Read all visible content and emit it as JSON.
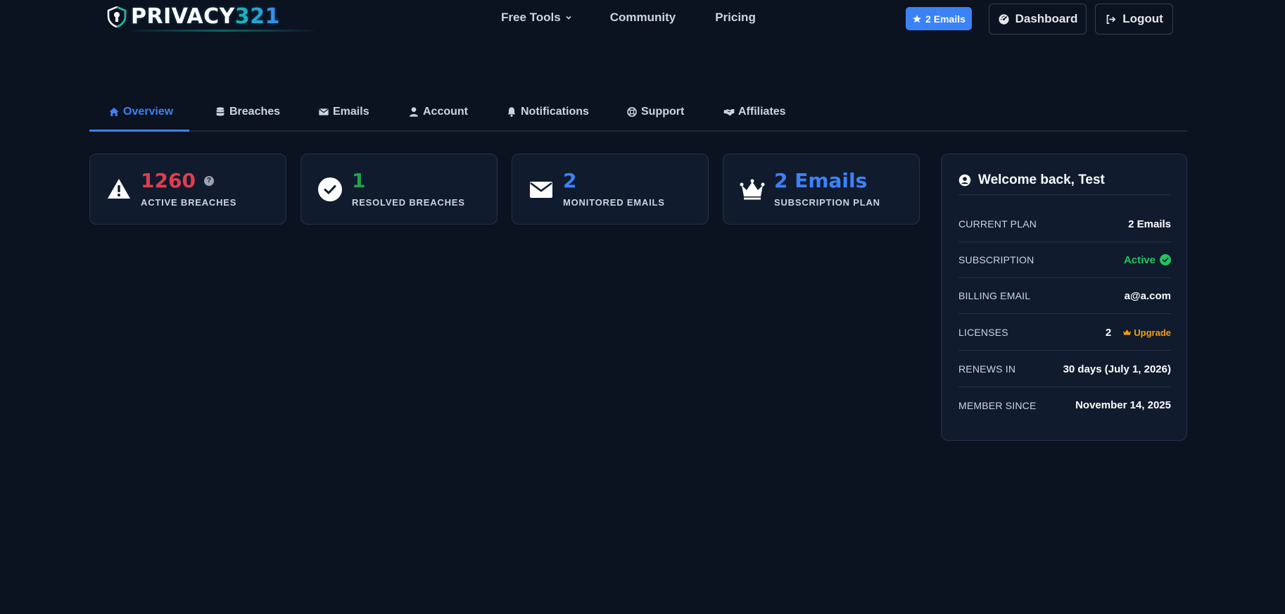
{
  "brand": {
    "name_main": "PRIVACY",
    "name_num": "321"
  },
  "nav": {
    "free_tools": "Free Tools",
    "community": "Community",
    "pricing": "Pricing",
    "plan_badge": "2 Emails",
    "dashboard": "Dashboard",
    "logout": "Logout"
  },
  "tabs": [
    {
      "label": "Overview",
      "icon": "home-icon",
      "active": true
    },
    {
      "label": "Breaches",
      "icon": "database-icon"
    },
    {
      "label": "Emails",
      "icon": "envelope-icon"
    },
    {
      "label": "Account",
      "icon": "user-icon"
    },
    {
      "label": "Notifications",
      "icon": "bell-icon"
    },
    {
      "label": "Support",
      "icon": "lifering-icon"
    },
    {
      "label": "Affiliates",
      "icon": "handshake-icon"
    }
  ],
  "stats": [
    {
      "value": "1260",
      "label": "ACTIVE BREACHES",
      "color": "#e03e4f",
      "icon": "warning-icon",
      "help": "?"
    },
    {
      "value": "1",
      "label": "RESOLVED BREACHES",
      "color": "#22a34a",
      "icon": "check-circle-icon"
    },
    {
      "value": "2",
      "label": "MONITORED EMAILS",
      "color": "#3b82f6",
      "icon": "envelope-icon"
    },
    {
      "value": "2 Emails",
      "label": "SUBSCRIPTION PLAN",
      "color": "#3b82f6",
      "icon": "crown-icon"
    }
  ],
  "account": {
    "welcome": "Welcome back, Test",
    "rows": [
      {
        "key": "CURRENT PLAN",
        "value": "2 Emails"
      },
      {
        "key": "SUBSCRIPTION",
        "value": "Active"
      },
      {
        "key": "BILLING EMAIL",
        "value": "a@a.com"
      },
      {
        "key": "LICENSES",
        "value": "2",
        "action": "Upgrade"
      },
      {
        "key": "RENEWS IN",
        "value": "30 days (July 1, 2026)"
      },
      {
        "key": "MEMBER SINCE",
        "value": "November 14, 2025"
      }
    ]
  },
  "colors": {
    "accent": "#3b82f6",
    "danger": "#e03e4f",
    "success": "#22c55e",
    "warning": "#f59e0b",
    "background": "#0b1220",
    "card": "#111b2e"
  }
}
